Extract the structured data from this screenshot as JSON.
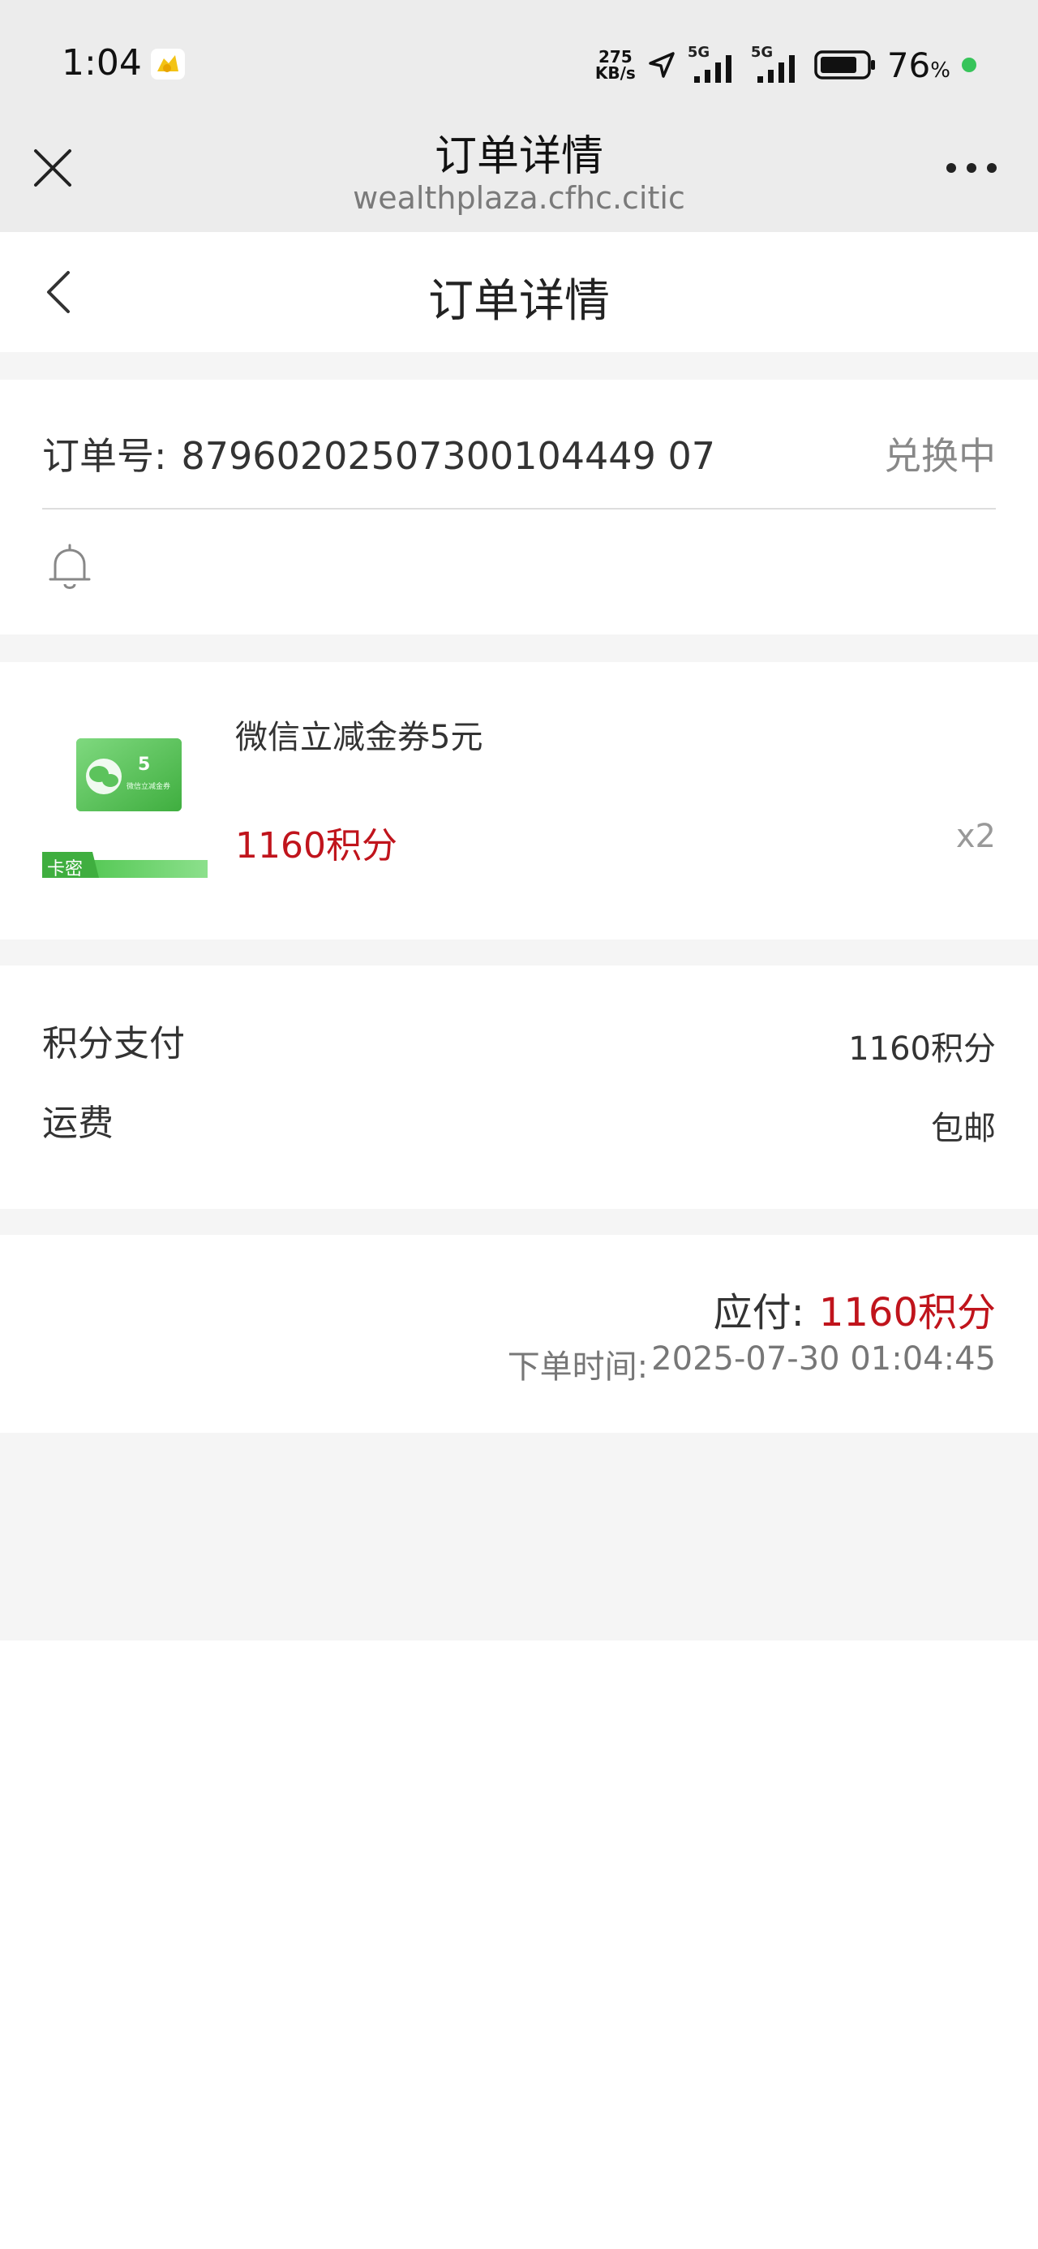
{
  "status_bar": {
    "time": "1:04",
    "net_speed_top": "275",
    "net_speed_bottom": "KB/s",
    "signal_1_label": "5G",
    "signal_2_label": "5G",
    "battery": "76",
    "battery_unit": "%"
  },
  "webview": {
    "title": "订单详情",
    "url": "wealthplaza.cfhc.citic"
  },
  "header": {
    "title": "订单详情"
  },
  "order": {
    "number_label": "订单号:",
    "number": "87960202507300104449 07",
    "status": "兑换中"
  },
  "product": {
    "name": "微信立减金券5元",
    "price": "1160积分",
    "quantity": "x2",
    "badge": "卡密",
    "image_value": "5",
    "image_subtitle": "微信立减金券"
  },
  "payment": {
    "points_label": "积分支付",
    "points_value": "1160积分",
    "shipping_label": "运费",
    "shipping_value": "包邮"
  },
  "total": {
    "label": "应付:",
    "value": "1160积分",
    "time_label": "下单时间:",
    "time_value": "2025-07-30 01:04:45"
  },
  "colors": {
    "accent_red": "#c0141c",
    "wechat_green": "#4cc94c",
    "status_dot": "#37c45a"
  }
}
